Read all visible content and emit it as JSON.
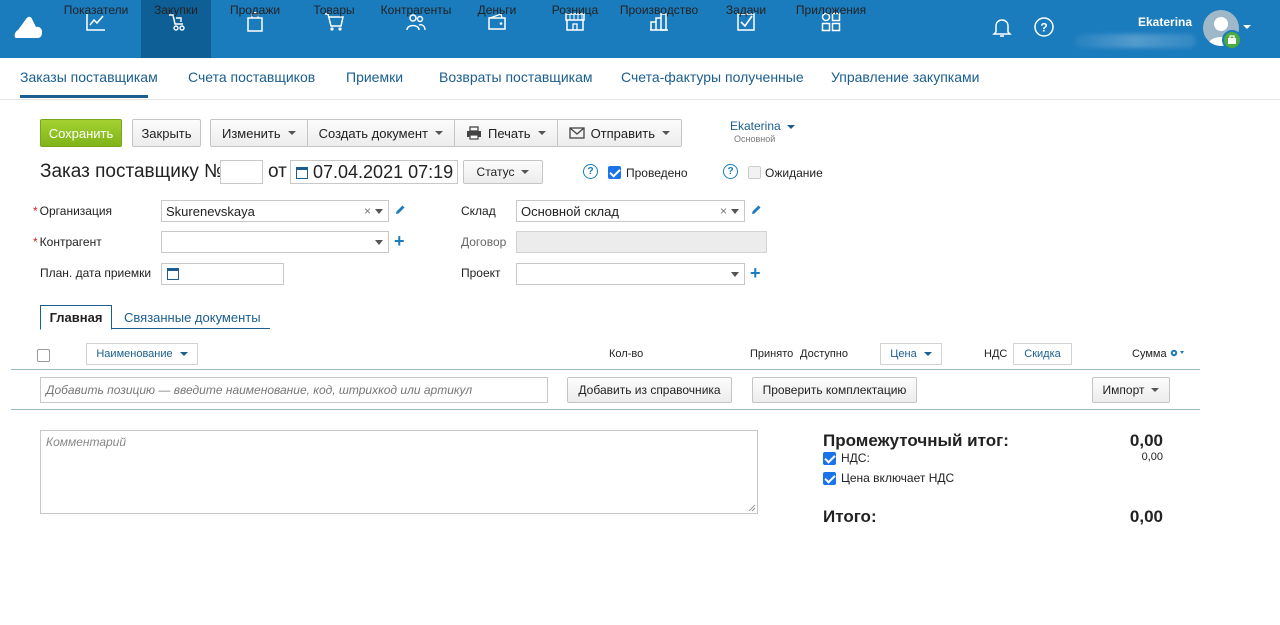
{
  "nav": {
    "items": [
      {
        "label": "Показатели",
        "icon": "chart-line-icon"
      },
      {
        "label": "Закупки",
        "icon": "purchases-icon",
        "active": true
      },
      {
        "label": "Продажи",
        "icon": "shopping-bag-icon"
      },
      {
        "label": "Товары",
        "icon": "cart-icon"
      },
      {
        "label": "Контрагенты",
        "icon": "people-icon"
      },
      {
        "label": "Деньги",
        "icon": "wallet-icon"
      },
      {
        "label": "Розница",
        "icon": "store-icon"
      },
      {
        "label": "Производство",
        "icon": "factory-icon"
      },
      {
        "label": "Задачи",
        "icon": "checkbox-icon"
      },
      {
        "label": "Приложения",
        "icon": "apps-icon"
      }
    ],
    "user_name": "Ekaterina",
    "accent": "#1a7bbd",
    "active_bg": "#0e5f96"
  },
  "subnav": {
    "tabs": [
      "Заказы поставщикам",
      "Счета поставщиков",
      "Приемки",
      "Возвраты поставщикам",
      "Счета-фактуры полученные",
      "Управление закупками"
    ]
  },
  "toolbar": {
    "save": "Сохранить",
    "close": "Закрыть",
    "edit": "Изменить",
    "create_doc": "Создать документ",
    "print": "Печать",
    "send": "Отправить",
    "owner": "Ekaterina",
    "owner_sub": "Основной"
  },
  "header": {
    "title": "Заказ поставщику №",
    "number": "",
    "ot": "от",
    "date": "07.04.2021 07:19",
    "status": "Статус",
    "posted_label": "Проведено",
    "posted": true,
    "waiting_label": "Ожидание",
    "waiting": false,
    "help": "?"
  },
  "form": {
    "organization_label": "Организация",
    "organization_value": "Skurenevskaya",
    "counterparty_label": "Контрагент",
    "counterparty_value": "",
    "plan_date_label": "План. дата приемки",
    "plan_date_value": "",
    "warehouse_label": "Склад",
    "warehouse_value": "Основной склад",
    "contract_label": "Договор",
    "contract_value": "",
    "project_label": "Проект",
    "project_value": "",
    "required_mark": "*",
    "clear_mark": "×",
    "add_mark": "+"
  },
  "tabs": {
    "main": "Главная",
    "related": "Связанные документы"
  },
  "table": {
    "name": "Наименование",
    "qty": "Кол-во",
    "received": "Принято",
    "available": "Доступно",
    "price": "Цена",
    "vat": "НДС",
    "discount": "Скидка",
    "sum": "Сумма"
  },
  "positions": {
    "add_placeholder": "Добавить позицию — введите наименование, код, штрихкод или артикул",
    "add_from_catalog": "Добавить из справочника",
    "check_kit": "Проверить комплектацию",
    "import": "Импорт"
  },
  "comment": {
    "placeholder": "Комментарий"
  },
  "totals": {
    "subtotal_label": "Промежуточный итог:",
    "subtotal_value": "0,00",
    "vat_label": "НДС:",
    "vat_value": "0,00",
    "vat_checked": true,
    "price_incl_vat_label": "Цена включает НДС",
    "price_incl_vat_checked": true,
    "total_label": "Итого:",
    "total_value": "0,00"
  }
}
